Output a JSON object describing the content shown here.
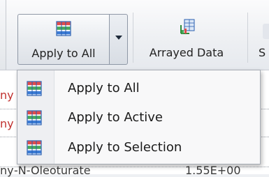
{
  "ribbon": {
    "apply_button": {
      "label": "Apply to All",
      "icon": "stack-table-icon"
    },
    "arrayed_button": {
      "label": "Arrayed Data",
      "icon": "arrayed-data-icon"
    },
    "clipped_button": {
      "label": "S"
    }
  },
  "menu": {
    "items": [
      {
        "label": "Apply to All",
        "icon": "stack-table-icon"
      },
      {
        "label": "Apply to Active",
        "icon": "stack-table-icon"
      },
      {
        "label": "Apply to Selection",
        "icon": "stack-table-icon"
      }
    ]
  },
  "sheet": {
    "fragments": [
      "ny",
      "ny",
      "ny",
      "-N-Oleoturate",
      "1.55E+00"
    ]
  },
  "colors": {
    "accent_red": "#c0302e",
    "icon_green": "#2e8b3a",
    "icon_blue": "#2a5fb0"
  }
}
